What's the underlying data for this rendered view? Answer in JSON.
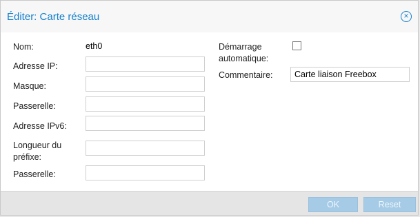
{
  "dialog": {
    "title": "Éditer: Carte réseau",
    "close_icon": "close-circle-icon"
  },
  "left": {
    "name_label": "Nom:",
    "name_value": "eth0",
    "ip_label": "Adresse IP:",
    "ip_value": "",
    "mask_label": "Masque:",
    "mask_value": "",
    "gateway_label": "Passerelle:",
    "gateway_value": "",
    "ipv6_label": "Adresse IPv6:",
    "ipv6_value": "",
    "prefix_label_line1": "Longueur du",
    "prefix_label_line2": "préfixe:",
    "prefix_value": "",
    "gateway6_label": "Passerelle:",
    "gateway6_value": ""
  },
  "right": {
    "autostart_label_line1": "Démarrage",
    "autostart_label_line2": "automatique:",
    "autostart_checked": false,
    "comment_label": "Commentaire:",
    "comment_value": "Carte liaison Freebox"
  },
  "footer": {
    "ok_label": "OK",
    "reset_label": "Reset"
  },
  "colors": {
    "title": "#157fcc",
    "button_disabled": "#a6cbe6"
  }
}
